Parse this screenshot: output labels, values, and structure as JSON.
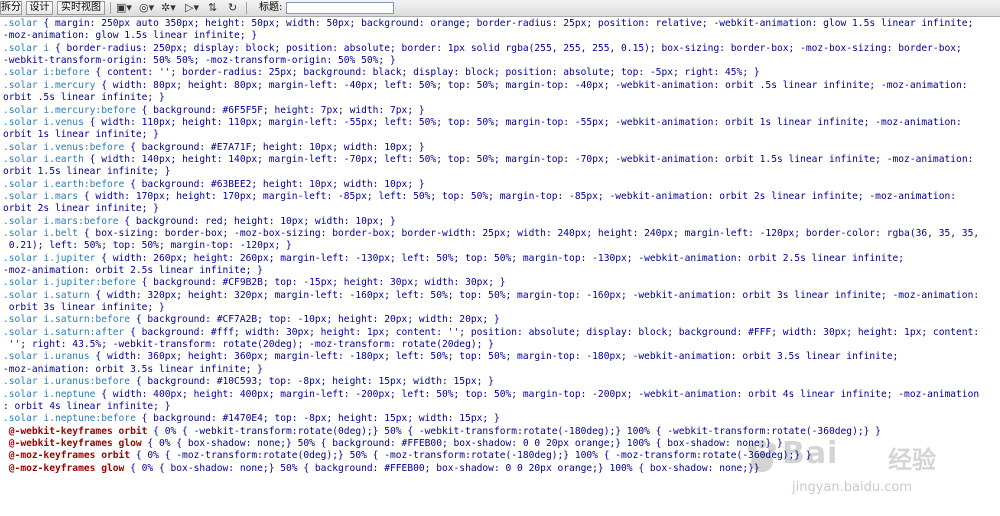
{
  "toolbar": {
    "buttons": [
      "拆分",
      "设计",
      "实时视图"
    ],
    "title_label": "标题:",
    "title_value": "",
    "icons": [
      "multiscreen-icon",
      "preview-icon",
      "debug-icon",
      "inspect-icon",
      "file-manage-icon",
      "refresh-icon"
    ]
  },
  "code_lines": [
    {
      "sel": ".solar",
      "text": " { margin: 250px auto 350px; height: 50px; width: 50px; background: orange; border-radius: 25px; position: relative; -webkit-animation: glow 1.5s linear infinite;"
    },
    {
      "sel": "",
      "text": "-moz-animation: glow 1.5s linear infinite; }"
    },
    {
      "sel": ".solar i",
      "text": " { border-radius: 250px; display: block; position: absolute; border: 1px solid rgba(255, 255, 255, 0.15); box-sizing: border-box; -moz-box-sizing: border-box;"
    },
    {
      "sel": "",
      "text": "-webkit-transform-origin: 50% 50%; -moz-transform-origin: 50% 50%; }"
    },
    {
      "sel": ".solar i:before",
      "text": " { content: ''; border-radius: 25px; background: black; display: block; position: absolute; top: -5px; right: 45%; }"
    },
    {
      "sel": ".solar i.mercury",
      "text": " { width: 80px; height: 80px; margin-left: -40px; left: 50%; top: 50%; margin-top: -40px; -webkit-animation: orbit .5s linear infinite; -moz-animation:"
    },
    {
      "sel": "",
      "text": "orbit .5s linear infinite; }"
    },
    {
      "sel": ".solar i.mercury:before",
      "text": " { background: #6F5F5F; height: 7px; width: 7px; }"
    },
    {
      "sel": ".solar i.venus",
      "text": " { width: 110px; height: 110px; margin-left: -55px; left: 50%; top: 50%; margin-top: -55px; -webkit-animation: orbit 1s linear infinite; -moz-animation:"
    },
    {
      "sel": "",
      "text": "orbit 1s linear infinite; }"
    },
    {
      "sel": ".solar i.venus:before",
      "text": " { background: #E7A71F; height: 10px; width: 10px; }"
    },
    {
      "sel": ".solar i.earth",
      "text": " { width: 140px; height: 140px; margin-left: -70px; left: 50%; top: 50%; margin-top: -70px; -webkit-animation: orbit 1.5s linear infinite; -moz-animation:"
    },
    {
      "sel": "",
      "text": "orbit 1.5s linear infinite; }"
    },
    {
      "sel": ".solar i.earth:before",
      "text": " { background: #63BEE2; height: 10px; width: 10px; }"
    },
    {
      "sel": ".solar i.mars",
      "text": " { width: 170px; height: 170px; margin-left: -85px; left: 50%; top: 50%; margin-top: -85px; -webkit-animation: orbit 2s linear infinite; -moz-animation:"
    },
    {
      "sel": "",
      "text": "orbit 2s linear infinite; }"
    },
    {
      "sel": ".solar i.mars:before",
      "text": " { background: red; height: 10px; width: 10px; }"
    },
    {
      "sel": ".solar i.belt",
      "text": " { box-sizing: border-box; -moz-box-sizing: border-box; border-width: 25px; width: 240px; height: 240px; margin-left: -120px; border-color: rgba(36, 35, 35,"
    },
    {
      "sel": "",
      "text": " 0.21); left: 50%; top: 50%; margin-top: -120px; }"
    },
    {
      "sel": ".solar i.jupiter",
      "text": " { width: 260px; height: 260px; margin-left: -130px; left: 50%; top: 50%; margin-top: -130px; -webkit-animation: orbit 2.5s linear infinite;"
    },
    {
      "sel": "",
      "text": "-moz-animation: orbit 2.5s linear infinite; }"
    },
    {
      "sel": ".solar i.jupiter:before",
      "text": " { background: #CF9B2B; top: -15px; height: 30px; width: 30px; }"
    },
    {
      "sel": ".solar i.saturn",
      "text": " { width: 320px; height: 320px; margin-left: -160px; left: 50%; top: 50%; margin-top: -160px; -webkit-animation: orbit 3s linear infinite; -moz-animation:"
    },
    {
      "sel": "",
      "text": " orbit 3s linear infinite; }"
    },
    {
      "sel": ".solar i.saturn:before",
      "text": " { background: #CF7A2B; top: -10px; height: 20px; width: 20px; }"
    },
    {
      "sel": ".solar i.saturn:after",
      "text": " { background: #fff; width: 30px; height: 1px; content: ''; position: absolute; display: block; background: #FFF; width: 30px; height: 1px; content:"
    },
    {
      "sel": "",
      "text": " ''; right: 43.5%; -webkit-transform: rotate(20deg); -moz-transform: rotate(20deg); }"
    },
    {
      "sel": ".solar i.uranus",
      "text": " { width: 360px; height: 360px; margin-left: -180px; left: 50%; top: 50%; margin-top: -180px; -webkit-animation: orbit 3.5s linear infinite;"
    },
    {
      "sel": "",
      "text": "-moz-animation: orbit 3.5s linear infinite; }"
    },
    {
      "sel": ".solar i.uranus:before",
      "text": " { background: #10C593; top: -8px; height: 15px; width: 15px; }"
    },
    {
      "sel": ".solar i.neptune",
      "text": " { width: 400px; height: 400px; margin-left: -200px; left: 50%; top: 50%; margin-top: -200px; -webkit-animation: orbit 4s linear infinite; -moz-animation"
    },
    {
      "sel": "",
      "text": ": orbit 4s linear infinite; }"
    },
    {
      "sel": ".solar i.neptune:before",
      "text": " { background: #1470E4; top: -8px; height: 15px; width: 15px; }"
    },
    {
      "sel": " @-webkit-keyframes orbit",
      "text": " { 0% { -webkit-transform:rotate(0deg);} 50% { -webkit-transform:rotate(-180deg);} 100% { -webkit-transform:rotate(-360deg);} }"
    },
    {
      "sel": " @-webkit-keyframes glow",
      "text": " { 0% { box-shadow: none;} 50% { background: #FFEB00; box-shadow: 0 0 20px orange;} 100% { box-shadow: none;} }"
    },
    {
      "sel": " @-moz-keyframes orbit",
      "text": " { 0% { -moz-transform:rotate(0deg);} 50% { -moz-transform:rotate(-180deg);} 100% { -moz-transform:rotate(-360deg);} }"
    },
    {
      "sel": " @-moz-keyframes glow",
      "text": " { 0% { box-shadow: none;} 50% { background: #FFEB00; box-shadow: 0 0 20px orange;} 100% { box-shadow: none;}}"
    }
  ],
  "watermark": {
    "logo": "Bai",
    "cn": "经验",
    "url": "jingyan.baidu.com"
  }
}
